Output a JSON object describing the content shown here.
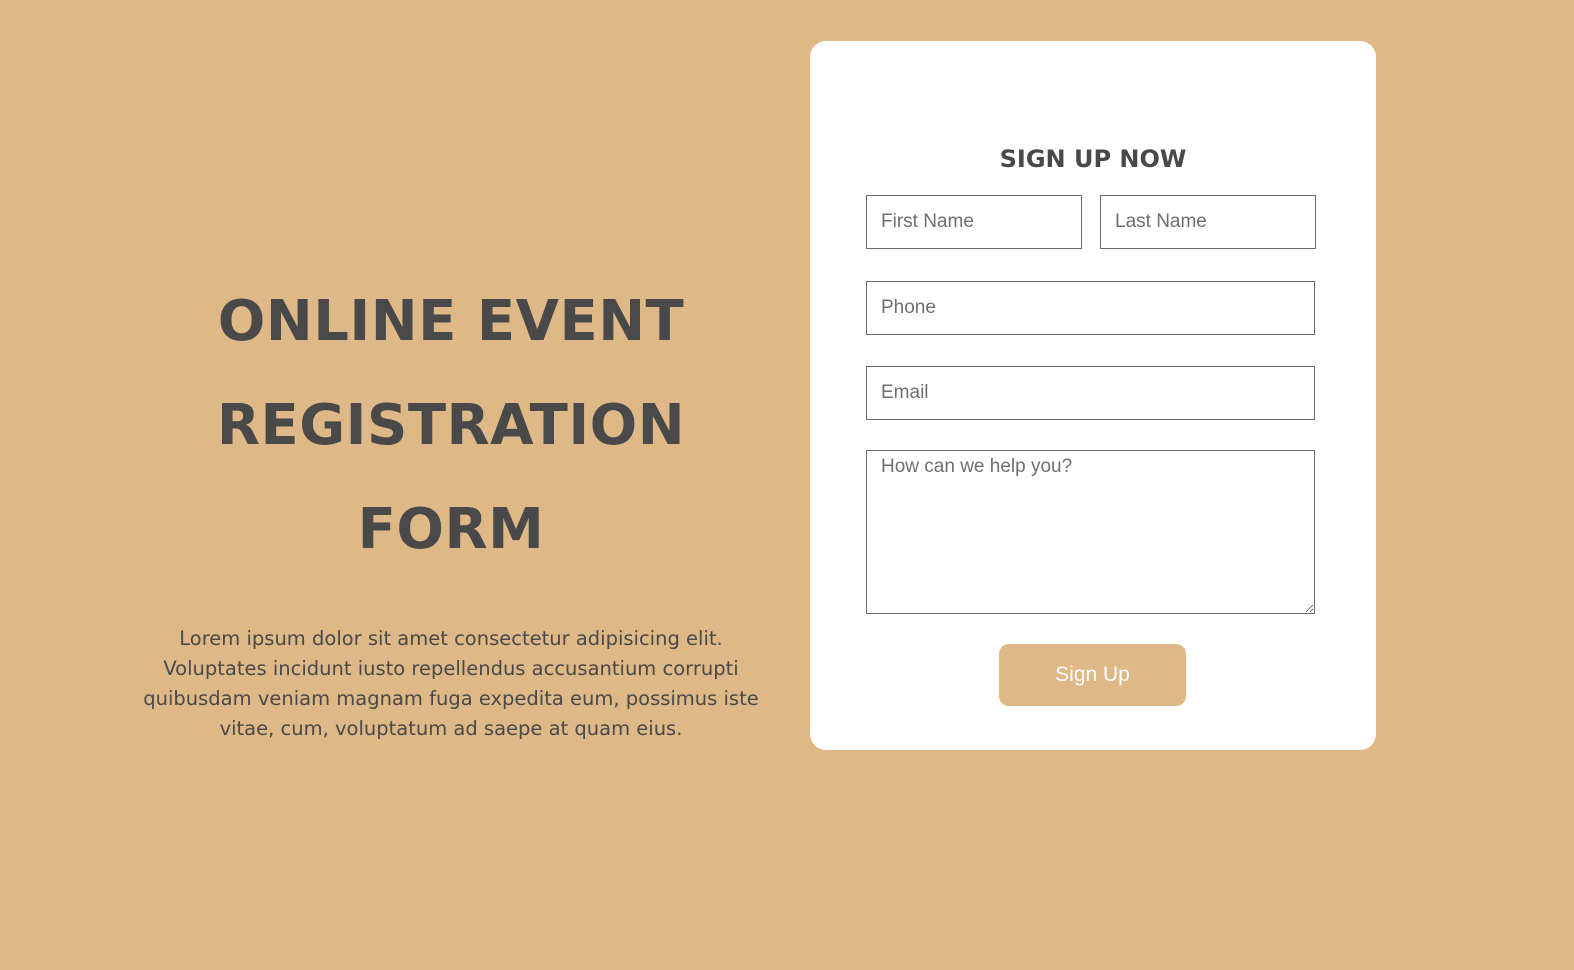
{
  "hero": {
    "title_lines": [
      "ONLINE EVENT",
      "REGISTRATION",
      "FORM"
    ],
    "description": "Lorem ipsum dolor sit amet consectetur adipisicing elit. Voluptates incidunt iusto repellendus accusantium corrupti quibusdam veniam magnam fuga expedita eum, possimus iste vitae, cum, voluptatum ad saepe at quam eius."
  },
  "form": {
    "title": "SIGN UP NOW",
    "first_name_placeholder": "First Name",
    "last_name_placeholder": "Last Name",
    "phone_placeholder": "Phone",
    "email_placeholder": "Email",
    "message_placeholder": "How can we help you?",
    "submit_label": "Sign Up"
  },
  "colors": {
    "background": "#deb887",
    "accent": "#deb887",
    "text": "#494949",
    "card": "#ffffff"
  }
}
